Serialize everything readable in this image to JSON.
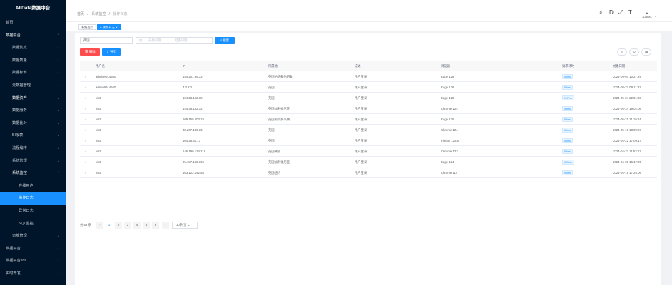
{
  "app": {
    "title": "AllData数据中台"
  },
  "sidebar": {
    "items": [
      {
        "label": "首页",
        "level": 0,
        "chevron": ""
      },
      {
        "label": "数据中台",
        "level": 0,
        "chevron": "⌃",
        "bright": true
      },
      {
        "label": "数据集成",
        "level": 1,
        "chevron": "⌄"
      },
      {
        "label": "数据质量",
        "level": 1,
        "chevron": "⌄"
      },
      {
        "label": "数据标准",
        "level": 1,
        "chevron": "⌄"
      },
      {
        "label": "元数据管理",
        "level": 1,
        "chevron": "⌄"
      },
      {
        "label": "数据资产",
        "level": 1,
        "chevron": "⌄",
        "bright": true
      },
      {
        "label": "数据服务",
        "level": 1,
        "chevron": "⌄"
      },
      {
        "label": "数据比对",
        "level": 1,
        "chevron": "⌄"
      },
      {
        "label": "BI报表",
        "level": 1,
        "chevron": "⌄"
      },
      {
        "label": "流程编排",
        "level": 1,
        "chevron": "⌄"
      },
      {
        "label": "系统管理",
        "level": 1,
        "chevron": "⌄"
      },
      {
        "label": "系统监控",
        "level": 1,
        "chevron": "⌃",
        "bright": true
      },
      {
        "label": "在线用户",
        "level": 2,
        "chevron": ""
      },
      {
        "label": "操作日志",
        "level": 2,
        "chevron": "",
        "active": true
      },
      {
        "label": "异常日志",
        "level": 2,
        "chevron": ""
      },
      {
        "label": "SQL监控",
        "level": 2,
        "chevron": ""
      },
      {
        "label": "运维管理",
        "level": 1,
        "chevron": "⌄"
      },
      {
        "label": "数据平台",
        "level": 0,
        "chevron": "⌄"
      },
      {
        "label": "数据平台k8s",
        "level": 0,
        "chevron": "⌄"
      },
      {
        "label": "实时开发",
        "level": 0,
        "chevron": "⌄"
      }
    ]
  },
  "breadcrumb": {
    "items": [
      "首页",
      "系统监控",
      "操作日志"
    ],
    "sep": "/"
  },
  "header_icons": {
    "search": "⌕",
    "doc": "D",
    "fullscreen": "⤢",
    "font": "T",
    "avatar_text": "ALLDATA",
    "caret": "▾"
  },
  "tags": {
    "home": "系统首页",
    "current": "● 操作日志 ×"
  },
  "search": {
    "keyword_value": "英国",
    "date_icon": "▤",
    "start_placeholder": "开始日期",
    "date_sep": "-",
    "end_placeholder": "结束日期",
    "search_button": "⌕ 搜索"
  },
  "toolbar": {
    "delete_button": "🗑 删除",
    "export_button": "⇩ 导出",
    "tool_search": "⌕",
    "tool_refresh": "↻",
    "tool_columns": "▦"
  },
  "table": {
    "headers": [
      "",
      "用户名",
      "IP",
      "所属地",
      "描述",
      "浏览器",
      "请求耗时",
      "创建日期"
    ],
    "rows": [
      {
        "expand": "›",
        "user": "admin#914560",
        "ip": "154.201.95.33",
        "location": "英国伯明翰伯明翰",
        "desc": "用户登录",
        "browser": "Edge 128",
        "duration": "90ms",
        "date": "2024-09-07 10:27:29"
      },
      {
        "expand": "›",
        "user": "admin#914560",
        "ip": "4.2.2.2",
        "location": "英国",
        "desc": "用户登录",
        "browser": "Edge 128",
        "duration": "97ms",
        "date": "2024-08-27 09:11:32"
      },
      {
        "expand": "›",
        "user": "test",
        "ip": "104.28.192.18",
        "location": "英国",
        "desc": "用户登录",
        "browser": "Edge 125",
        "duration": "117ms",
        "date": "2024-05-24 22:01:03"
      },
      {
        "expand": "›",
        "user": "test",
        "ip": "144.38.182.32",
        "location": "英国加利福尼亚",
        "desc": "用户登录",
        "browser": "Chrome 124",
        "duration": "99ms",
        "date": "2024-05-24 19:02:06"
      },
      {
        "expand": "›",
        "user": "test",
        "ip": "109.159.203.18",
        "location": "英国南卡罗来纳",
        "desc": "用户登录",
        "browser": "Edge 125",
        "duration": "97ms",
        "date": "2024-05-21 11:19:44"
      },
      {
        "expand": "›",
        "user": "test",
        "ip": "38.207.136.33",
        "location": "英国",
        "desc": "用户登录",
        "browser": "Chrome 124",
        "duration": "99ms",
        "date": "2024-05-16 18:09:27"
      },
      {
        "expand": "›",
        "user": "test",
        "ip": "104.28.51.13",
        "location": "英国",
        "desc": "用户登录",
        "browser": "Firefox 125.0",
        "duration": "90ms",
        "date": "2024-04-22 17:09:17"
      },
      {
        "expand": "›",
        "user": "test",
        "ip": "146.190.134.219",
        "location": "英国微软",
        "desc": "用户登录",
        "browser": "Chrome 123",
        "duration": "97ms",
        "date": "2024-04-22 11:53:22"
      },
      {
        "expand": "›",
        "user": "test",
        "ip": "95.187.165.160",
        "location": "英国加利福尼亚",
        "desc": "用户登录",
        "browser": "Edge 124",
        "duration": "101ms",
        "date": "2024-04-20 16:17:25"
      },
      {
        "expand": "›",
        "user": "test",
        "ip": "163.123.192.54",
        "location": "英国纽约",
        "desc": "用户登录",
        "browser": "Chrome 114",
        "duration": "90ms",
        "date": "2024-04-19 17:25:06"
      }
    ]
  },
  "pagination": {
    "total": "共 53 条",
    "prev": "‹",
    "pages": [
      "1",
      "2",
      "3",
      "4",
      "5",
      "6"
    ],
    "next": "›",
    "current": "1",
    "page_size": "10条/页 ⌄"
  }
}
